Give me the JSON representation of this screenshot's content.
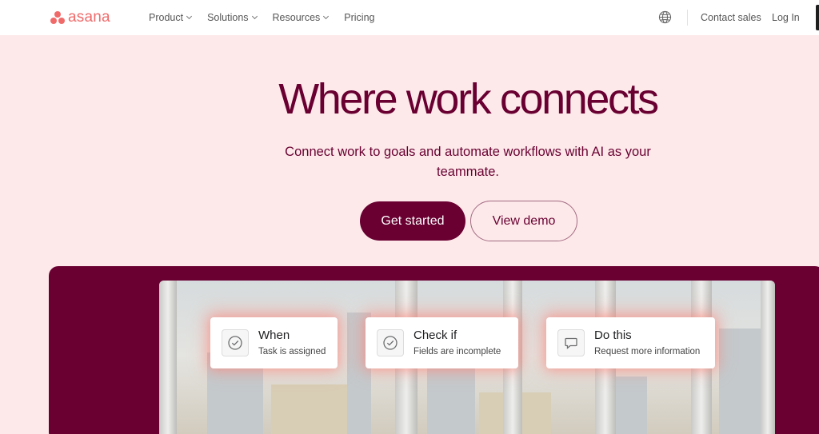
{
  "brand": {
    "name": "asana",
    "color": "#f06a6a"
  },
  "nav": {
    "links": [
      {
        "label": "Product",
        "has_dropdown": true
      },
      {
        "label": "Solutions",
        "has_dropdown": true
      },
      {
        "label": "Resources",
        "has_dropdown": true
      },
      {
        "label": "Pricing",
        "has_dropdown": false
      }
    ],
    "globe_icon": "globe-icon",
    "contact_label": "Contact sales",
    "login_label": "Log In"
  },
  "hero": {
    "title": "Where work connects",
    "subtitle": "Connect work to goals and automate workflows with AI as your teammate.",
    "primary_cta": "Get started",
    "secondary_cta": "View demo"
  },
  "workflow": {
    "cards": [
      {
        "title": "When",
        "description": "Task is assigned",
        "icon": "check-circle-icon"
      },
      {
        "title": "Check if",
        "description": "Fields are incomplete",
        "icon": "check-circle-icon"
      },
      {
        "title": "Do this",
        "description": "Request more information",
        "icon": "comment-icon"
      }
    ]
  },
  "colors": {
    "primary": "#690031",
    "background": "#fde9ea",
    "brand_coral": "#f06a6a",
    "white": "#ffffff"
  }
}
